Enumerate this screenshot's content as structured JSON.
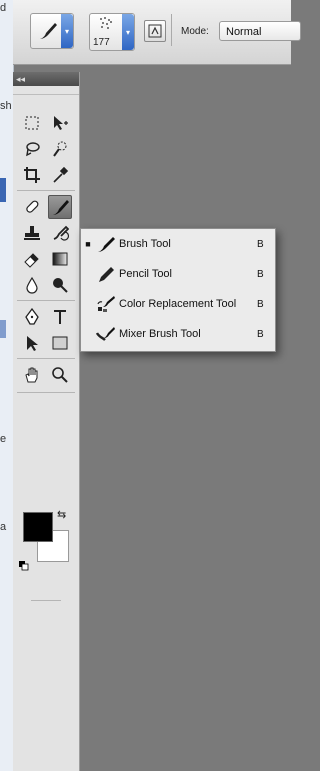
{
  "window_edge": {
    "fragments": [
      "d",
      "sh",
      "e",
      "a"
    ]
  },
  "options_bar": {
    "brush_size": "177",
    "mode_label": "Mode:",
    "mode_value": "Normal"
  },
  "tools_panel": {
    "collapse_glyph": "◂◂",
    "tools": [
      {
        "name": "marquee-tool-icon"
      },
      {
        "name": "move-tool-icon"
      },
      {
        "name": "lasso-tool-icon"
      },
      {
        "name": "quick-selection-tool-icon"
      },
      {
        "name": "crop-tool-icon"
      },
      {
        "name": "eyedropper-tool-icon"
      },
      {
        "name": "spot-healing-tool-icon"
      },
      {
        "name": "brush-tool-icon"
      },
      {
        "name": "clone-stamp-tool-icon"
      },
      {
        "name": "history-brush-tool-icon"
      },
      {
        "name": "eraser-tool-icon"
      },
      {
        "name": "gradient-tool-icon"
      },
      {
        "name": "blur-tool-icon"
      },
      {
        "name": "dodge-tool-icon"
      },
      {
        "name": "pen-tool-icon"
      },
      {
        "name": "type-tool-icon"
      },
      {
        "name": "path-selection-tool-icon"
      },
      {
        "name": "rectangle-tool-icon"
      },
      {
        "name": "hand-tool-icon"
      },
      {
        "name": "zoom-tool-icon"
      }
    ],
    "foreground_color": "#000000",
    "background_color": "#ffffff"
  },
  "flyout_menu": {
    "items": [
      {
        "label": "Brush Tool",
        "shortcut": "B",
        "selected": true,
        "icon": "brush-icon"
      },
      {
        "label": "Pencil Tool",
        "shortcut": "B",
        "selected": false,
        "icon": "pencil-icon"
      },
      {
        "label": "Color Replacement Tool",
        "shortcut": "B",
        "selected": false,
        "icon": "color-replacement-icon"
      },
      {
        "label": "Mixer Brush Tool",
        "shortcut": "B",
        "selected": false,
        "icon": "mixer-brush-icon"
      }
    ],
    "selected_marker": "■"
  },
  "colors": {
    "canvas": "#7a7a7a",
    "accent_blue": "#2f66c4"
  }
}
